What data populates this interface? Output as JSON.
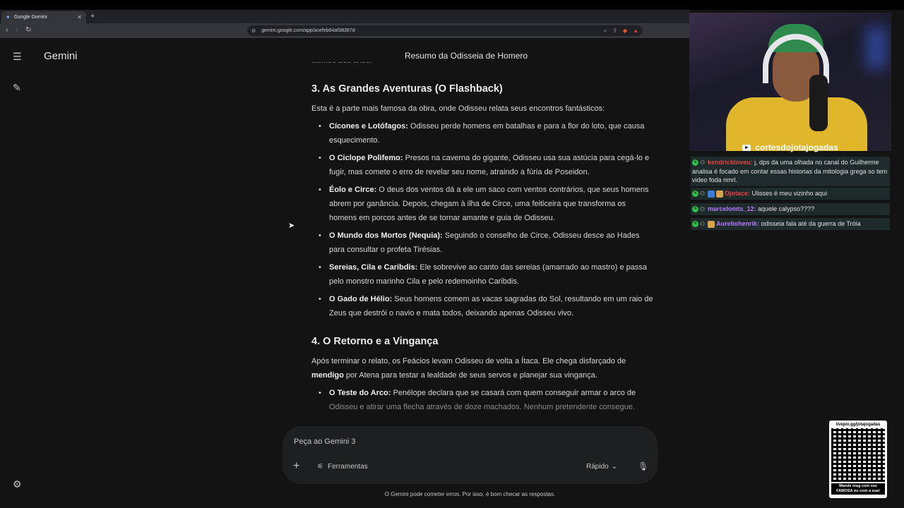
{
  "browser": {
    "tab_title": "Google Gemini",
    "url": "gemini.google.com/app/acefeb64af38387d"
  },
  "app": {
    "brand": "Gemini",
    "conversation_title": "Resumo da Odisseia de Homero"
  },
  "content": {
    "partial_top": "últimos dez anos.",
    "section3": {
      "heading": "3. As Grandes Aventuras (O Flashback)",
      "intro": "Esta é a parte mais famosa da obra, onde Odisseu relata seus encontros fantásticos:",
      "items": [
        {
          "title": "Cícones e Lotófagos:",
          "text": " Odisseu perde homens em batalhas e para a flor do loto, que causa esquecimento."
        },
        {
          "title": "O Ciclope Polifemo:",
          "text": " Presos na caverna do gigante, Odisseu usa sua astúcia para cegá-lo e fugir, mas comete o erro de revelar seu nome, atraindo a fúria de Poseidon."
        },
        {
          "title": "Éolo e Circe:",
          "text": " O deus dos ventos dá a ele um saco com ventos contrários, que seus homens abrem por ganância. Depois, chegam à ilha de Circe, uma feiticeira que transforma os homens em porcos antes de se tornar amante e guia de Odisseu."
        },
        {
          "title": "O Mundo dos Mortos (Nequia):",
          "text": " Seguindo o conselho de Circe, Odisseu desce ao Hades para consultar o profeta Tirésias."
        },
        {
          "title": "Sereias, Cila e Caribdis:",
          "text": " Ele sobrevive ao canto das sereias (amarrado ao mastro) e passa pelo monstro marinho Cila e pelo redemoinho Caribdis."
        },
        {
          "title": "O Gado de Hélio:",
          "text": " Seus homens comem as vacas sagradas do Sol, resultando em um raio de Zeus que destrói o navio e mata todos, deixando apenas Odisseu vivo."
        }
      ]
    },
    "section4": {
      "heading": "4. O Retorno e a Vingança",
      "intro_a": "Após terminar o relato, os Feácios levam Odisseu de volta a Ítaca. Ele chega disfarçado de ",
      "intro_bold": "mendigo",
      "intro_b": " por Atena para testar a lealdade de seus servos e planejar sua vingança.",
      "items": [
        {
          "title": "O Teste do Arco:",
          "text": " Penélope declara que se casará com quem conseguir armar o arco de ",
          "faded": "Odisseu e atirar uma flecha através de doze machados. Nenhum pretendente consegue."
        }
      ]
    }
  },
  "input": {
    "placeholder": "Peça ao Gemini 3",
    "tools_label": "Ferramentas",
    "model_label": "Rápido",
    "disclaimer": "O Gemini pode cometer erros. Por isso, é bom checar as respostas."
  },
  "overlay": {
    "channel": "cortesdojotajogadas",
    "chat": [
      {
        "user": "kendrickloveu:",
        "user_color": "#e8414a",
        "text": " j, dps da uma olhada no canal do Guilherme analisa é focado em contar essas historias da mitologia grega so tem video foda nmrl."
      },
      {
        "user": "Ojotace:",
        "user_color": "#e8414a",
        "text": " Ulisses é meu vizinho aqui"
      },
      {
        "user": "marcelomts_12:",
        "user_color": "#b27aff",
        "text": " aquele calypso????"
      },
      {
        "user": "Aureliohenrik:",
        "user_color": "#b27aff",
        "text": " odisseia fala até da guerra de Tróia"
      }
    ],
    "qr_title": "livepix.gg/jotajogadas",
    "qr_caption": "Mande msg com voz FAMOSA ou com a sua!"
  },
  "icons": {
    "menu": "menu-icon",
    "new_chat": "edit-icon",
    "settings": "gear-icon",
    "plus": "plus-icon",
    "tools": "tune-icon",
    "mic": "mic-icon"
  }
}
